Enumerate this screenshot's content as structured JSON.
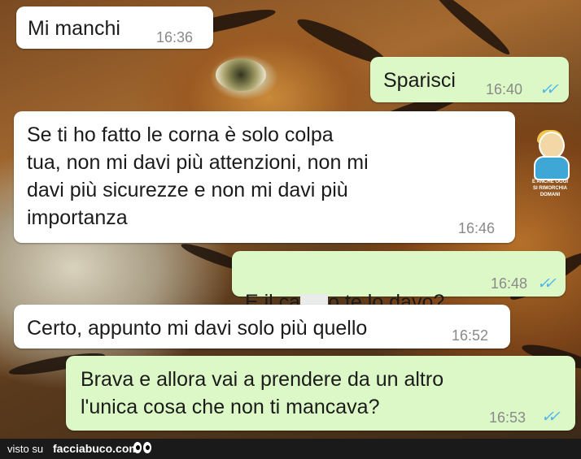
{
  "messages": [
    {
      "direction": "incoming",
      "text": "Mi manchi",
      "time": "16:36"
    },
    {
      "direction": "outgoing",
      "text": "Sparisci",
      "time": "16:40",
      "ticks": "✓✓"
    },
    {
      "direction": "incoming",
      "text": "Se ti ho fatto le corna è solo colpa\ntua, non mi davi più attenzioni, non mi\ndavi più sicurezze e non mi davi più\nimportanza",
      "time": "16:46"
    },
    {
      "direction": "outgoing",
      "text_before": "E il ca",
      "text_after": "o te lo davo?",
      "time": "16:48",
      "ticks": "✓✓"
    },
    {
      "direction": "incoming",
      "text": "Certo, appunto mi davi solo più quello",
      "time": "16:52"
    },
    {
      "direction": "outgoing",
      "text": "Brava e allora vai a prendere da un altro\nl'unica cosa che non ti mancava?",
      "time": "16:53",
      "ticks": "✓✓"
    }
  ],
  "sticker": {
    "caption": "E ANCHE OGGI\nSI RIMORCHIA DOMANI"
  },
  "footer": {
    "visto_su": "visto su",
    "site": "facciabuco.com"
  },
  "colors": {
    "incoming": "#ffffff",
    "outgoing": "#dcf8c6",
    "read_ticks": "#4fb6ec",
    "time": "#8a8a8a",
    "footer": "#1a1a1a"
  },
  "icons": {
    "read_receipt": "double-check-icon",
    "logo": "eyes-icon"
  }
}
